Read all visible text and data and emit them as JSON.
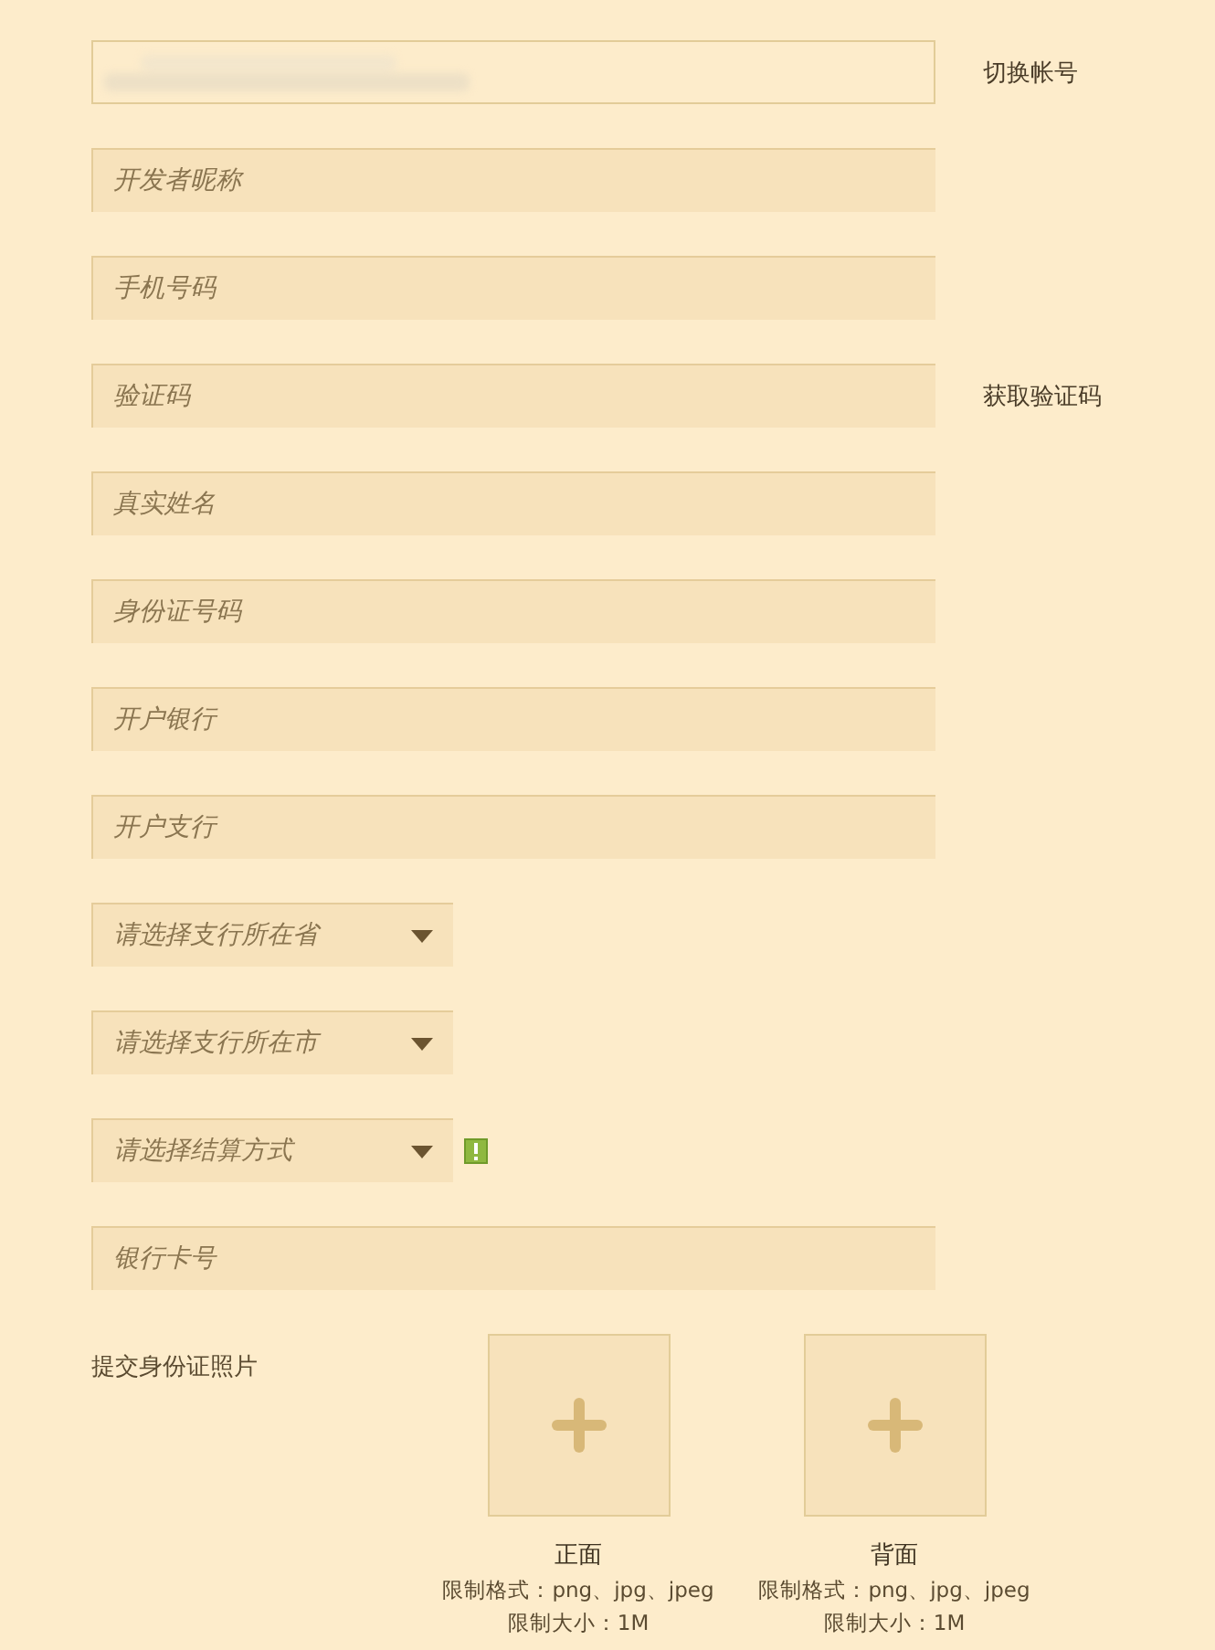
{
  "fields": [
    {
      "kind": "account",
      "action": "切换帐号"
    },
    {
      "kind": "input",
      "placeholder": "开发者昵称"
    },
    {
      "kind": "input",
      "placeholder": "手机号码"
    },
    {
      "kind": "input",
      "placeholder": "验证码",
      "action": "获取验证码"
    },
    {
      "kind": "input",
      "placeholder": "真实姓名"
    },
    {
      "kind": "input",
      "placeholder": "身份证号码"
    },
    {
      "kind": "input",
      "placeholder": "开户银行"
    },
    {
      "kind": "input",
      "placeholder": "开户支行"
    },
    {
      "kind": "select",
      "placeholder": "请选择支行所在省",
      "warning": false
    },
    {
      "kind": "select",
      "placeholder": "请选择支行所在市",
      "warning": false
    },
    {
      "kind": "select",
      "placeholder": "请选择结算方式",
      "warning": true
    },
    {
      "kind": "input",
      "placeholder": "银行卡号"
    }
  ],
  "photos": {
    "label": "提交身份证照片",
    "slots": [
      {
        "title": "正面",
        "format": "限制格式：png、jpg、jpeg",
        "size": "限制大小：1M"
      },
      {
        "title": "背面",
        "format": "限制格式：png、jpg、jpeg",
        "size": "限制大小：1M"
      }
    ]
  }
}
